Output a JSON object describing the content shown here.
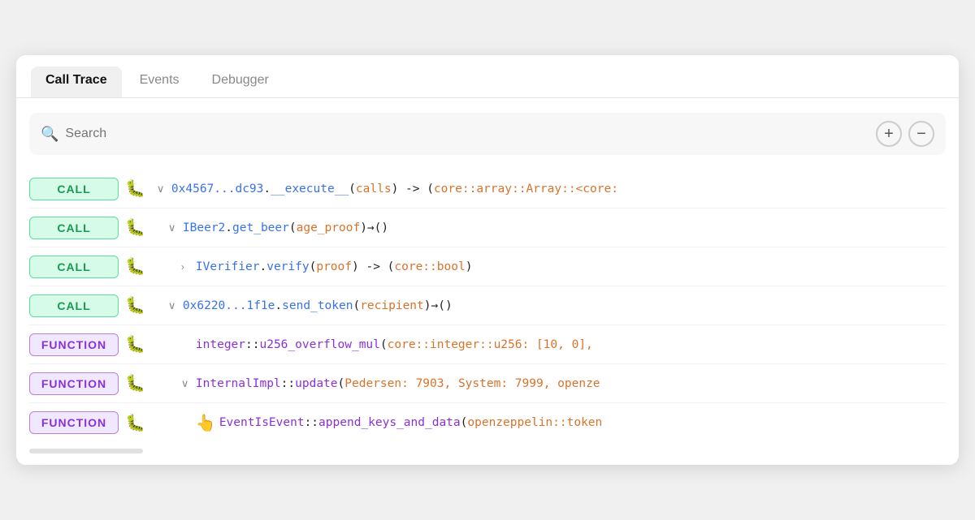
{
  "tabs": [
    {
      "label": "Call Trace",
      "active": true
    },
    {
      "label": "Events",
      "active": false
    },
    {
      "label": "Debugger",
      "active": false
    }
  ],
  "search": {
    "placeholder": "Search"
  },
  "zoom": {
    "plus_label": "+",
    "minus_label": "−"
  },
  "rows": [
    {
      "badge": "CALL",
      "badge_type": "call",
      "indent": 1,
      "chevron": "∨",
      "text_parts": [
        {
          "text": "0x4567...dc93",
          "color": "blue"
        },
        {
          "text": ".",
          "color": "dark"
        },
        {
          "text": "__execute__",
          "color": "blue"
        },
        {
          "text": "(",
          "color": "dark"
        },
        {
          "text": "calls",
          "color": "orange"
        },
        {
          "text": ") -> (",
          "color": "dark"
        },
        {
          "text": "core::array::Array::<core:",
          "color": "orange"
        }
      ]
    },
    {
      "badge": "CALL",
      "badge_type": "call",
      "indent": 2,
      "chevron": "∨",
      "text_parts": [
        {
          "text": "IBeer2",
          "color": "blue"
        },
        {
          "text": ".",
          "color": "dark"
        },
        {
          "text": "get_beer",
          "color": "blue"
        },
        {
          "text": "(",
          "color": "dark"
        },
        {
          "text": "age_proof",
          "color": "orange"
        },
        {
          "text": ")→()",
          "color": "dark"
        }
      ]
    },
    {
      "badge": "CALL",
      "badge_type": "call",
      "indent": 3,
      "chevron": ">",
      "text_parts": [
        {
          "text": "IVerifier",
          "color": "blue"
        },
        {
          "text": ".",
          "color": "dark"
        },
        {
          "text": "verify",
          "color": "blue"
        },
        {
          "text": "(",
          "color": "dark"
        },
        {
          "text": "proof",
          "color": "orange"
        },
        {
          "text": ") -> (",
          "color": "dark"
        },
        {
          "text": "core::bool",
          "color": "orange"
        },
        {
          "text": ")",
          "color": "dark"
        }
      ]
    },
    {
      "badge": "CALL",
      "badge_type": "call",
      "indent": 2,
      "chevron": "∨",
      "text_parts": [
        {
          "text": "0x6220...1f1e",
          "color": "blue"
        },
        {
          "text": ".",
          "color": "dark"
        },
        {
          "text": "send_token",
          "color": "blue"
        },
        {
          "text": "(",
          "color": "dark"
        },
        {
          "text": "recipient",
          "color": "orange"
        },
        {
          "text": ")→()",
          "color": "dark"
        }
      ]
    },
    {
      "badge": "FUNCTION",
      "badge_type": "function",
      "indent": 3,
      "chevron": "",
      "text_parts": [
        {
          "text": "integer",
          "color": "purple"
        },
        {
          "text": "::",
          "color": "dark"
        },
        {
          "text": "u256_overflow_mul",
          "color": "purple"
        },
        {
          "text": "(",
          "color": "dark"
        },
        {
          "text": "core::integer::u256: [10, 0],",
          "color": "orange"
        }
      ]
    },
    {
      "badge": "FUNCTION",
      "badge_type": "function",
      "indent": 3,
      "chevron": "∨",
      "text_parts": [
        {
          "text": "InternalImpl",
          "color": "purple"
        },
        {
          "text": "::",
          "color": "dark"
        },
        {
          "text": "update",
          "color": "purple"
        },
        {
          "text": "(",
          "color": "dark"
        },
        {
          "text": "Pedersen: 7903, System: 7999, openze",
          "color": "orange"
        }
      ]
    },
    {
      "badge": "FUNCTION",
      "badge_type": "function",
      "indent": 3,
      "chevron": "",
      "cursor": true,
      "text_parts": [
        {
          "text": "EventIsEvent",
          "color": "purple"
        },
        {
          "text": "::",
          "color": "dark"
        },
        {
          "text": "append_keys_and_data",
          "color": "purple"
        },
        {
          "text": "(",
          "color": "dark"
        },
        {
          "text": "openzeppelin::token",
          "color": "orange"
        }
      ]
    }
  ],
  "colors": {
    "call_badge_bg": "#d6fbe8",
    "call_badge_border": "#5de09a",
    "call_badge_text": "#1a9950",
    "function_badge_bg": "#f0e8ff",
    "function_badge_border": "#c07ae8",
    "function_badge_text": "#8b30d9"
  }
}
